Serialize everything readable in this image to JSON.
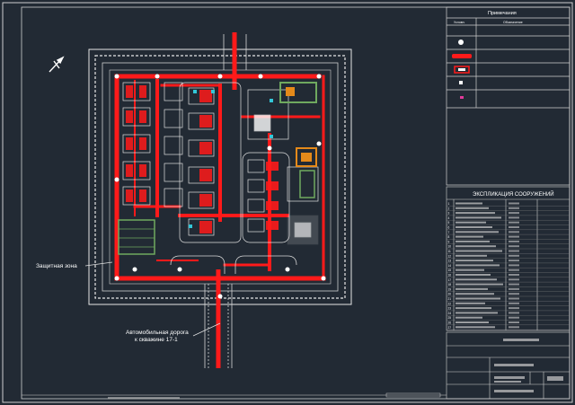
{
  "labels": {
    "legend_title": "Примечания",
    "legend_col1": "Условн.",
    "legend_col2": "Обозначение",
    "explication_title": "ЭКСПЛИКАЦИЯ СООРУЖЕНИЙ",
    "zone_label": "Защитная зона",
    "road_label_1": "Автомобильная дорога",
    "road_label_2": "к скважине 17-1"
  },
  "explication_rows": [
    "1",
    "2",
    "3",
    "4",
    "5",
    "6",
    "7",
    "8",
    "9",
    "10",
    "11",
    "12",
    "13",
    "14",
    "15",
    "16",
    "17",
    "18",
    "19",
    "20",
    "21",
    "22",
    "23",
    "24",
    "25",
    "26",
    "27"
  ],
  "colors": {
    "background": "#222a34",
    "line": "#d0d0d0",
    "accent": "#ff1a1a",
    "green": "#6fa95f",
    "orange": "#e58a1a",
    "cyan": "#33c7d8"
  }
}
